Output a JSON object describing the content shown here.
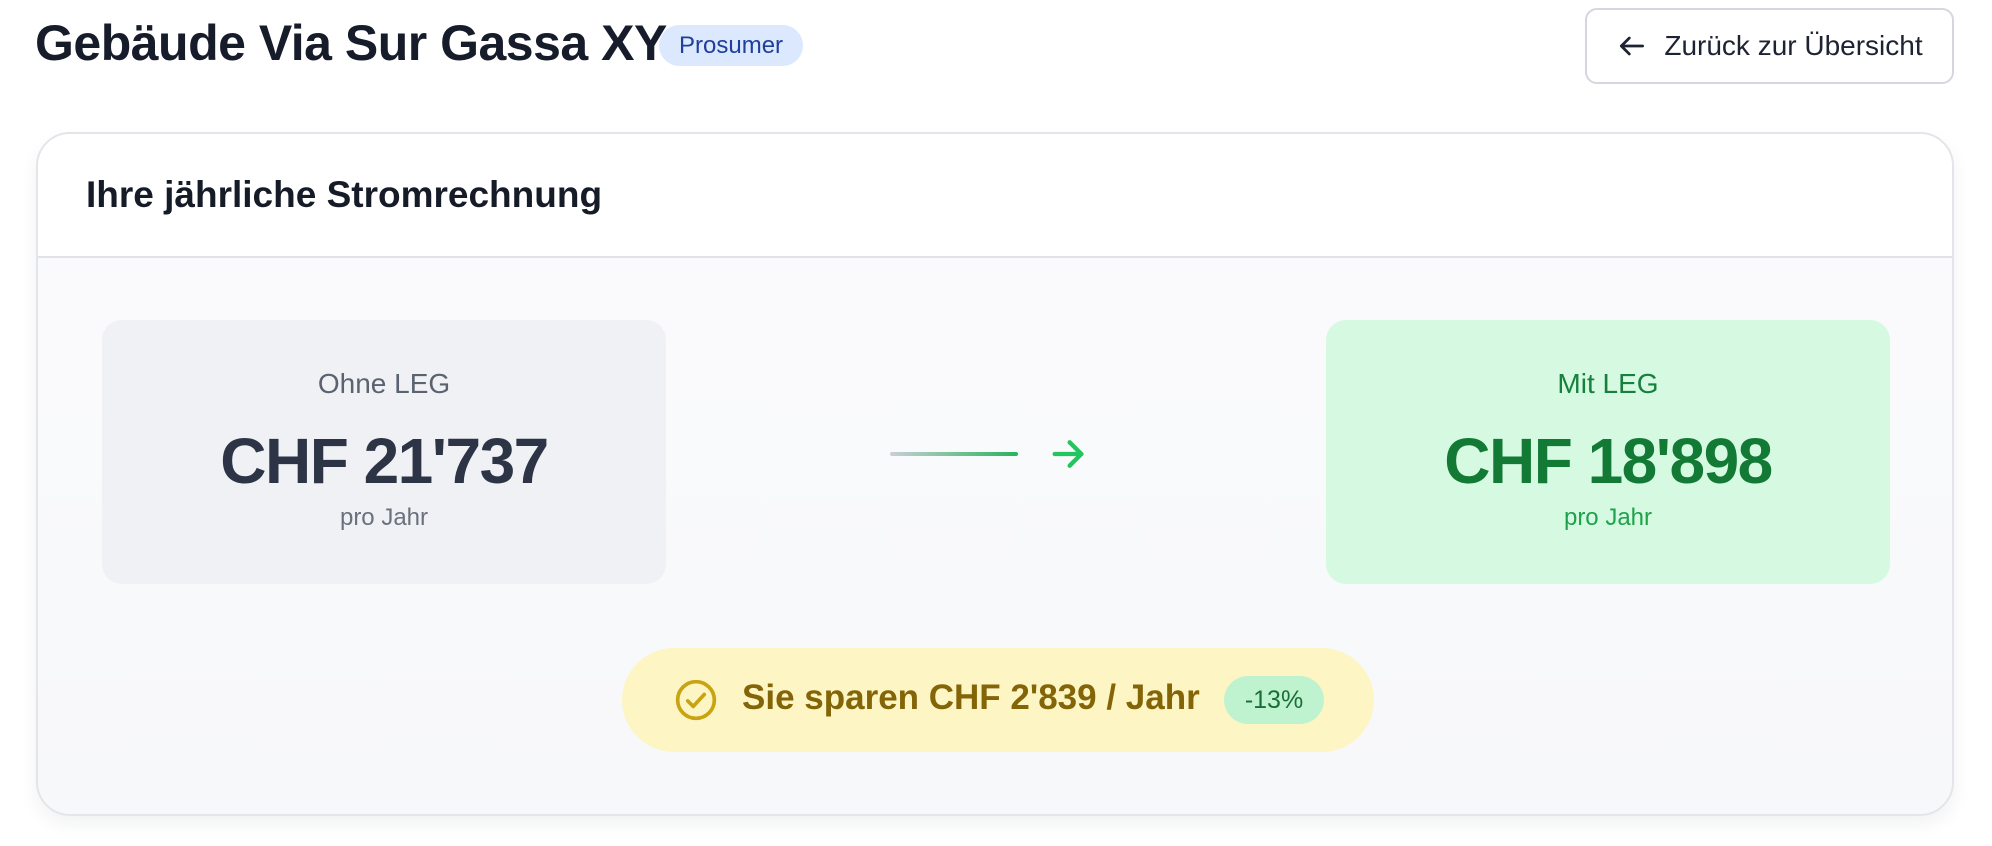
{
  "header": {
    "title": "Gebäude Via Sur Gassa XY",
    "badge": "Prosumer",
    "back_button": {
      "label": "Zurück zur Übersicht",
      "icon": "arrow-left-icon"
    }
  },
  "card": {
    "title": "Ihre jährliche Stromrechnung",
    "without_leg": {
      "label": "Ohne LEG",
      "value": "CHF 21'737",
      "period": "pro Jahr"
    },
    "with_leg": {
      "label": "Mit LEG",
      "value": "CHF 18'898",
      "period": "pro Jahr"
    },
    "arrow_icon": "arrow-right-icon",
    "savings": {
      "icon": "check-circle-icon",
      "text": "Sie sparen CHF 2'839 / Jahr",
      "percent": "-13%"
    }
  },
  "colors": {
    "badge_bg": "#dbe8fd",
    "badge_text": "#1f3f9a",
    "without_bg": "#eff1f5",
    "with_bg": "#d6f9e2",
    "with_text": "#127a35",
    "accent_green": "#22c55e",
    "savings_bg": "#fdf5c4",
    "savings_text": "#836406",
    "percent_bg": "#bff3cf"
  }
}
